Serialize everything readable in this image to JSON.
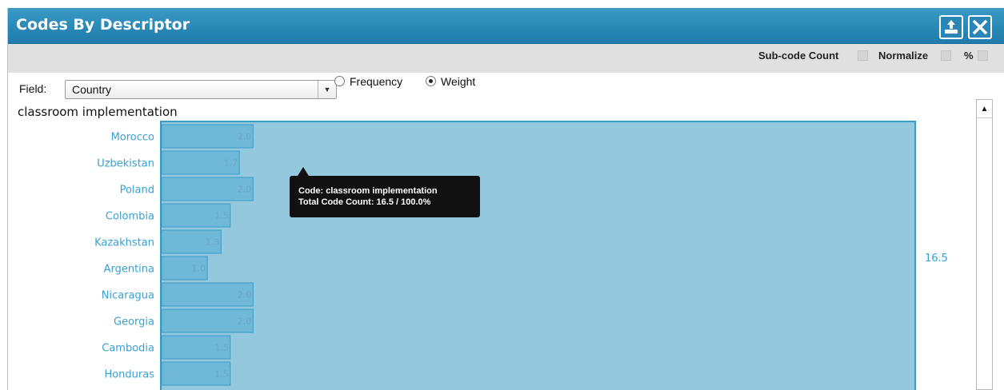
{
  "window": {
    "title": "Codes By Descriptor",
    "export_icon": "export-icon",
    "close_icon": "close-icon"
  },
  "options": {
    "subcode_count_label": "Sub-code Count",
    "normalize_label": "Normalize",
    "percent_label": "%"
  },
  "field": {
    "label": "Field:",
    "selected": "Country",
    "frequency_label": "Frequency",
    "weight_label": "Weight",
    "mode": "Weight"
  },
  "code_title": "classroom implementation",
  "tooltip": {
    "line1": "Code: classroom implementation",
    "line2": "Total Code Count: 16.5 / 100.0%"
  },
  "colors": {
    "bar": "#6fb8d8",
    "bar_stroke": "#3a9bc6",
    "total_fill": "#93c8df",
    "label": "#3aa0cf",
    "value": "#6aa6c4"
  },
  "chart_data": {
    "type": "bar",
    "orientation": "horizontal",
    "title": "classroom implementation",
    "categories": [
      "Morocco",
      "Uzbekistan",
      "Poland",
      "Colombia",
      "Kazakhstan",
      "Argentina",
      "Nicaragua",
      "Georgia",
      "Cambodia",
      "Honduras"
    ],
    "values": [
      2.0,
      1.7,
      2.0,
      1.5,
      1.3,
      1.0,
      2.0,
      2.0,
      1.5,
      1.5
    ],
    "value_labels": [
      "2.0",
      "1.7",
      "2.0",
      "1.5",
      "1.3",
      "1.0",
      "2.0",
      "2.0",
      "1.5",
      "1.5"
    ],
    "total": 16.5,
    "total_label": "16.5",
    "xlim": [
      0,
      16.5
    ]
  }
}
